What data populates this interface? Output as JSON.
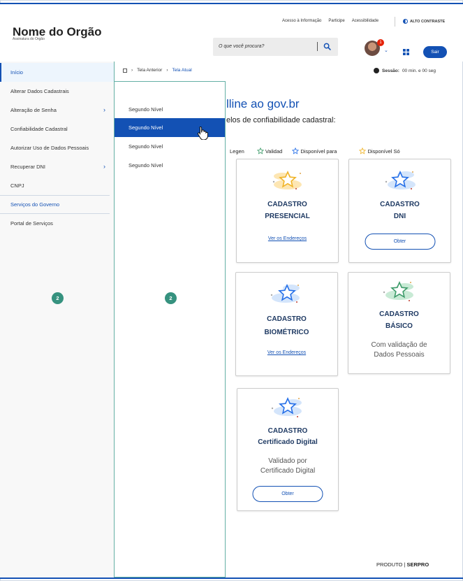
{
  "header": {
    "org_title": "Nome do Orgão",
    "org_subtitle": "Assinatura do Orgão",
    "links": [
      "Acesso à Informação",
      "Participe",
      "Acessibilidade"
    ],
    "contrast": "ALTO CONTRASTE",
    "search_placeholder": "O que você procura?",
    "notification_count": "1",
    "logout": "Sair"
  },
  "sidebar": {
    "items": [
      {
        "label": "Início"
      },
      {
        "label": "Alterar Dados Cadastrais"
      },
      {
        "label": "Alteração de Senha"
      },
      {
        "label": "Confiabilidade Cadastral"
      },
      {
        "label": "Autorizar Uso de Dados Pessoais"
      },
      {
        "label": "Recuperar DNI"
      },
      {
        "label": "CNPJ"
      },
      {
        "label": "Serviços do Governo"
      },
      {
        "label": "Portal de Serviços"
      }
    ],
    "badge": "2"
  },
  "submenu": {
    "items": [
      "Segundo Nível",
      "Segundo Nível",
      "Segundo Nível",
      "Segundo Nível"
    ],
    "badge": "2"
  },
  "breadcrumb": {
    "items": [
      "Tela Anterior",
      "Tela Atual"
    ]
  },
  "session": {
    "label": "Sessão:",
    "value": "00 min. e 00 seg"
  },
  "main": {
    "title": "lline ao gov.br",
    "subtitle": "elos de confiabilidade cadastral:",
    "legend": {
      "label": "Legen",
      "items": [
        "Validad",
        "Disponível para",
        "Disponível Só"
      ]
    },
    "cards": [
      {
        "title1": "CADASTRO",
        "title2": "PRESENCIAL",
        "link": "Ver os Endereços"
      },
      {
        "title1": "CADASTRO",
        "title2": "DNI",
        "button": "Obter"
      },
      {
        "title1": "CADASTRO",
        "title2": "BIOMÉTRICO",
        "link": "Ver os Endereços"
      },
      {
        "title1": "CADASTRO",
        "title2": "BÁSICO",
        "desc1": "Com validação de",
        "desc2": "Dados Pessoais"
      },
      {
        "title1": "CADASTRO",
        "title2": "Certificado Digital",
        "desc1": "Validado por",
        "desc2": "Certificado Digital",
        "button": "Obter"
      }
    ]
  },
  "footer": {
    "product": "PRODUTO",
    "brand": "SERPRO"
  },
  "colors": {
    "primary": "#1351b4",
    "teal": "#36927f",
    "star_gold": "#f0b429",
    "star_blue": "#2670e8",
    "star_green": "#3f9c6b"
  }
}
